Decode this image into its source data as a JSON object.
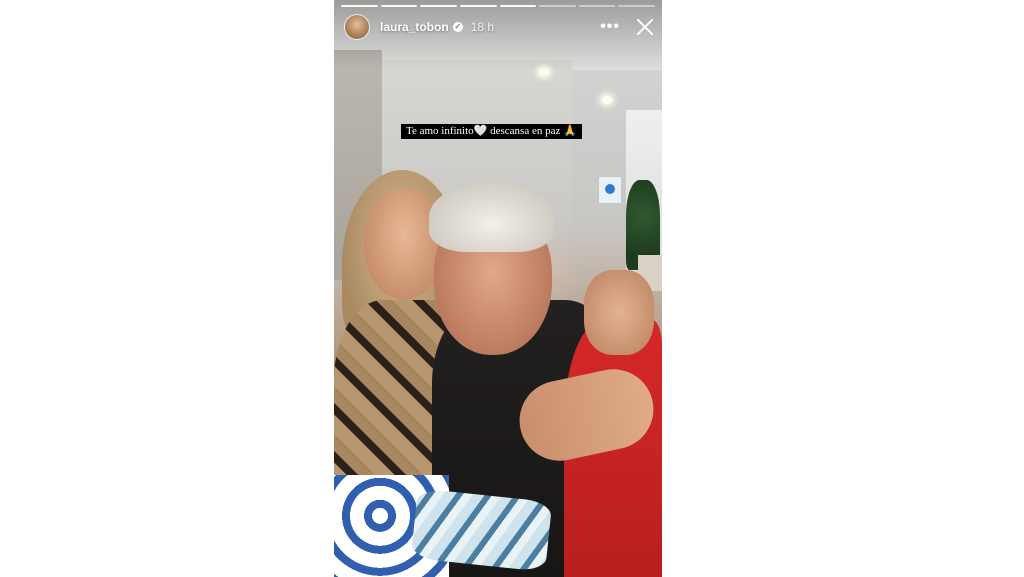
{
  "story": {
    "progress": {
      "total_segments": 8,
      "current_segment": 5
    },
    "user": {
      "username": "laura_tobon",
      "verified_icon": "verified-badge-icon",
      "time_ago": "18 h"
    },
    "actions": {
      "more_icon": "more-options-icon",
      "more_label": "•••",
      "close_icon": "close-icon"
    },
    "caption": "Te amo infinito🤍 descansa en paz 🙏"
  },
  "colors": {
    "page_background": "#ffffff",
    "caption_background": "#000000",
    "text_on_story": "#ffffff"
  }
}
